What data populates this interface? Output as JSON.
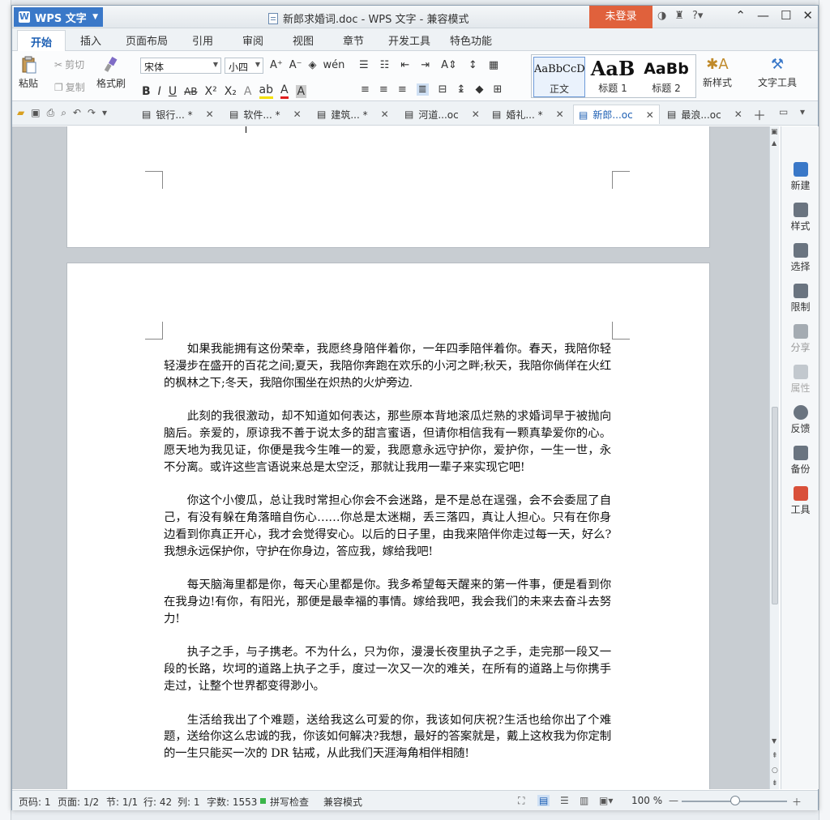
{
  "app": {
    "logo_label": "WPS 文字",
    "title": "新郎求婚词.doc - WPS 文字 - 兼容模式",
    "login_label": "未登录"
  },
  "menu": {
    "tabs": [
      "开始",
      "插入",
      "页面布局",
      "引用",
      "审阅",
      "视图",
      "章节",
      "开发工具",
      "特色功能"
    ]
  },
  "ribbon": {
    "paste": "粘贴",
    "cut": "剪切",
    "copy": "复制",
    "format_painter": "格式刷",
    "font_name": "宋体",
    "font_size": "小四",
    "styles": [
      {
        "sample": "AaBbCcD",
        "name": "正文"
      },
      {
        "sample": "AaB",
        "name": "标题 1"
      },
      {
        "sample": "AaBb",
        "name": "标题 2"
      }
    ],
    "new_style": "新样式",
    "text_tools": "文字工具"
  },
  "doc_tabs": [
    "银行... *",
    "软件... *",
    "建筑... *",
    "河道...oc",
    "婚礼... *",
    "新郎...oc",
    "最浪...oc"
  ],
  "document": {
    "paragraphs": [
      "如果我能拥有这份荣幸，我愿终身陪伴着你，一年四季陪伴着你。春天，我陪你轻轻漫步在盛开的百花之间;夏天，我陪你奔跑在欢乐的小河之畔;秋天，我陪你倘佯在火红的枫林之下;冬天，我陪你围坐在炽热的火炉旁边.",
      "此刻的我很激动，却不知道如何表达，那些原本背地滚瓜烂熟的求婚词早于被抛向脑后。亲爱的，原谅我不善于说太多的甜言蜜语，但请你相信我有一颗真挚爱你的心。愿天地为我见证，你便是我今生唯一的爱，我愿意永远守护你，爱护你，一生一世，永不分离。或许这些言语说来总是太空泛，那就让我用一辈子来实现它吧!",
      "你这个小傻瓜，总让我时常担心你会不会迷路，是不是总在逞强，会不会委屈了自己，有没有躲在角落暗自伤心……你总是太迷糊，丢三落四，真让人担心。只有在你身边看到你真正开心，我才会觉得安心。以后的日子里，由我来陪伴你走过每一天，好么?我想永远保护你，守护在你身边，答应我，嫁给我吧!",
      "每天脑海里都是你，每天心里都是你。我多希望每天醒来的第一件事，便是看到你在我身边!有你，有阳光，那便是最幸福的事情。嫁给我吧，我会我们的未来去奋斗去努力!",
      "执子之手，与子携老。不为什么，只为你，漫漫长夜里执子之手，走完那一段又一段的长路，坎坷的道路上执子之手，度过一次又一次的难关，在所有的道路上与你携手走过，让整个世界都变得渺小。",
      "生活给我出了个难题，送给我这么可爱的你，我该如何庆祝?生活也给你出了个难题，送给你这么忠诚的我，你该如何解决?我想，最好的答案就是，戴上这枚我为你定制的一生只能买一次的 DR 钻戒，从此我们天涯海角相伴相随!"
    ]
  },
  "side_panel": [
    "新建",
    "样式",
    "选择",
    "限制",
    "分享",
    "属性",
    "反馈",
    "备份",
    "工具"
  ],
  "status": {
    "page_num": "页码: 1",
    "pages": "页面: 1/2",
    "section": "节: 1/1",
    "row": "行: 42",
    "col": "列: 1",
    "word_count": "字数: 1553",
    "spell_check": "拼写检查",
    "compat_mode": "兼容模式",
    "zoom": "100 %",
    "zoom_fraction": 0.5
  },
  "colors": {
    "accent": "#3a78c8",
    "login": "#e0613c"
  }
}
